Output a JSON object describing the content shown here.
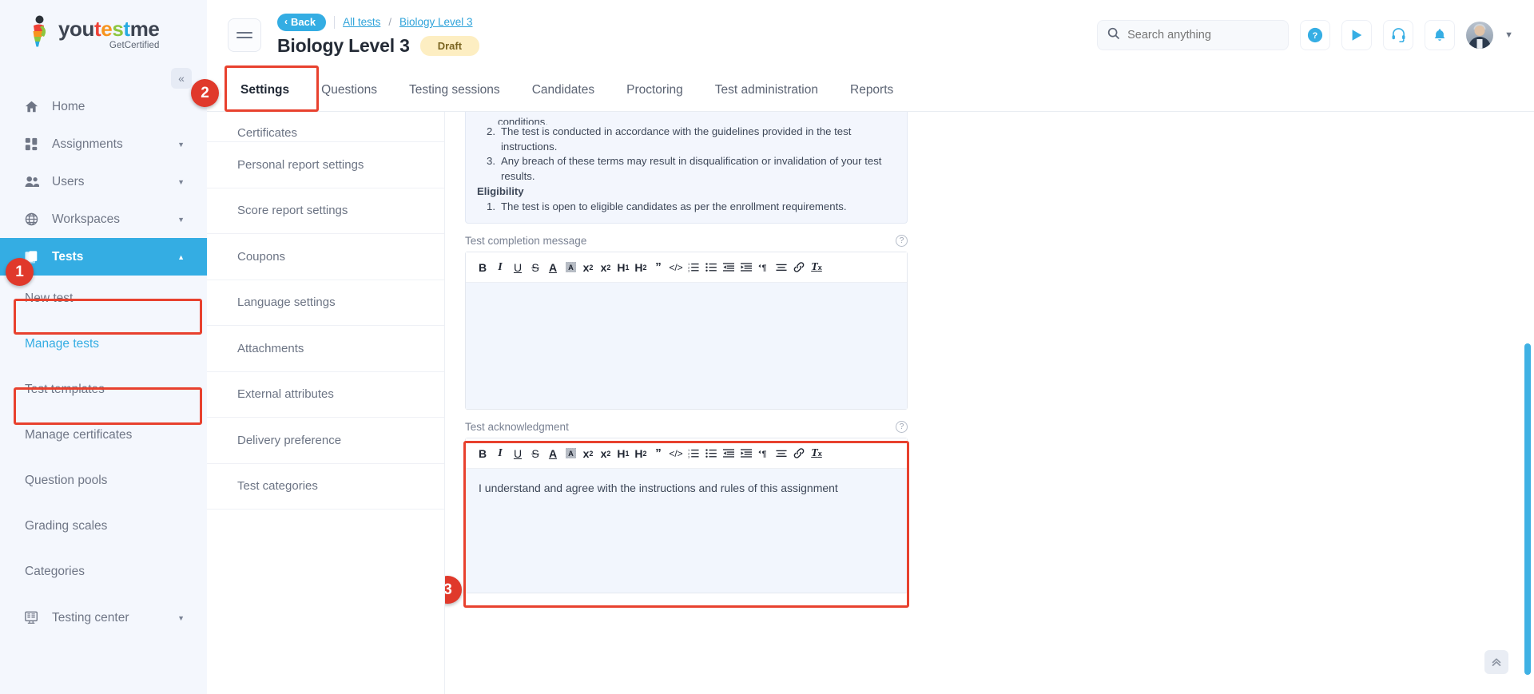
{
  "brand": {
    "name_parts": [
      "you",
      "t",
      "e",
      "s",
      "t",
      "me"
    ],
    "tagline": "GetCertified",
    "accent": "#34ade3"
  },
  "sidebar": {
    "collapse_label": "«",
    "items": [
      {
        "label": "Home",
        "icon": "home-icon",
        "type": "top",
        "expandable": false
      },
      {
        "label": "Assignments",
        "icon": "assignments-icon",
        "type": "top",
        "expandable": true
      },
      {
        "label": "Users",
        "icon": "users-icon",
        "type": "top",
        "expandable": true
      },
      {
        "label": "Workspaces",
        "icon": "workspaces-icon",
        "type": "top",
        "expandable": true
      },
      {
        "label": "Tests",
        "icon": "tests-icon",
        "type": "top",
        "expandable": true,
        "active": true
      },
      {
        "label": "New test",
        "type": "sub"
      },
      {
        "label": "Manage tests",
        "type": "sub",
        "highlighted": true
      },
      {
        "label": "Test templates",
        "type": "sub"
      },
      {
        "label": "Manage certificates",
        "type": "sub"
      },
      {
        "label": "Question pools",
        "type": "sub"
      },
      {
        "label": "Grading scales",
        "type": "sub"
      },
      {
        "label": "Categories",
        "type": "sub"
      },
      {
        "label": "Testing center",
        "icon": "testing-center-icon",
        "type": "top",
        "expandable": true
      }
    ]
  },
  "markers": [
    {
      "number": "1",
      "target": "sidebar-tests"
    },
    {
      "number": "2",
      "target": "tab-settings"
    },
    {
      "number": "3",
      "target": "test-acknowledgment-editor"
    }
  ],
  "header": {
    "back_label": "Back",
    "breadcrumb": [
      {
        "label": "All tests"
      },
      {
        "label": "Biology Level 3"
      }
    ],
    "breadcrumb_separator": "/",
    "title": "Biology Level 3",
    "status": "Draft",
    "search_placeholder": "Search anything",
    "search_value": "",
    "icons": [
      "help-icon",
      "play-icon",
      "support-headset-icon",
      "notification-bell-icon",
      "avatar",
      "chevron-down-icon"
    ]
  },
  "tabs": [
    {
      "label": "Settings",
      "active": true
    },
    {
      "label": "Questions",
      "active": false
    },
    {
      "label": "Testing sessions",
      "active": false
    },
    {
      "label": "Candidates",
      "active": false
    },
    {
      "label": "Proctoring",
      "active": false
    },
    {
      "label": "Test administration",
      "active": false
    },
    {
      "label": "Reports",
      "active": false
    }
  ],
  "settings_menu": [
    "Certificates",
    "Personal report settings",
    "Score report settings",
    "Coupons",
    "Language settings",
    "Attachments",
    "External attributes",
    "Delivery preference",
    "Test categories"
  ],
  "info_box": {
    "clipped_line": "conditions.",
    "items": [
      {
        "num": "2.",
        "text": "The test is conducted in accordance with the guidelines provided in the test instructions."
      },
      {
        "num": "3.",
        "text": "Any breach of these terms may result in disqualification or invalidation of your test results."
      }
    ],
    "section_heading": "Eligibility",
    "eligibility_items": [
      {
        "num": "1.",
        "text": "The test is open to eligible candidates as per the enrollment requirements."
      }
    ]
  },
  "toolbar_buttons": [
    "bold-icon",
    "italic-icon",
    "underline-icon",
    "strikethrough-icon",
    "text-color-icon",
    "highlight-color-icon",
    "subscript-icon",
    "superscript-icon",
    "heading-1-icon",
    "heading-2-icon",
    "blockquote-icon",
    "code-block-icon",
    "ordered-list-icon",
    "bullet-list-icon",
    "outdent-icon",
    "indent-icon",
    "text-direction-icon",
    "align-icon",
    "link-icon",
    "clear-format-icon"
  ],
  "fields": {
    "completion_message": {
      "label": "Test completion message",
      "value": "",
      "help": "?"
    },
    "acknowledgment": {
      "label": "Test acknowledgment",
      "value": "I understand and agree with the instructions and rules of this assignment",
      "help": "?"
    }
  },
  "footer_controls": {
    "scroll_top_icon": "chevron-double-up-icon"
  }
}
